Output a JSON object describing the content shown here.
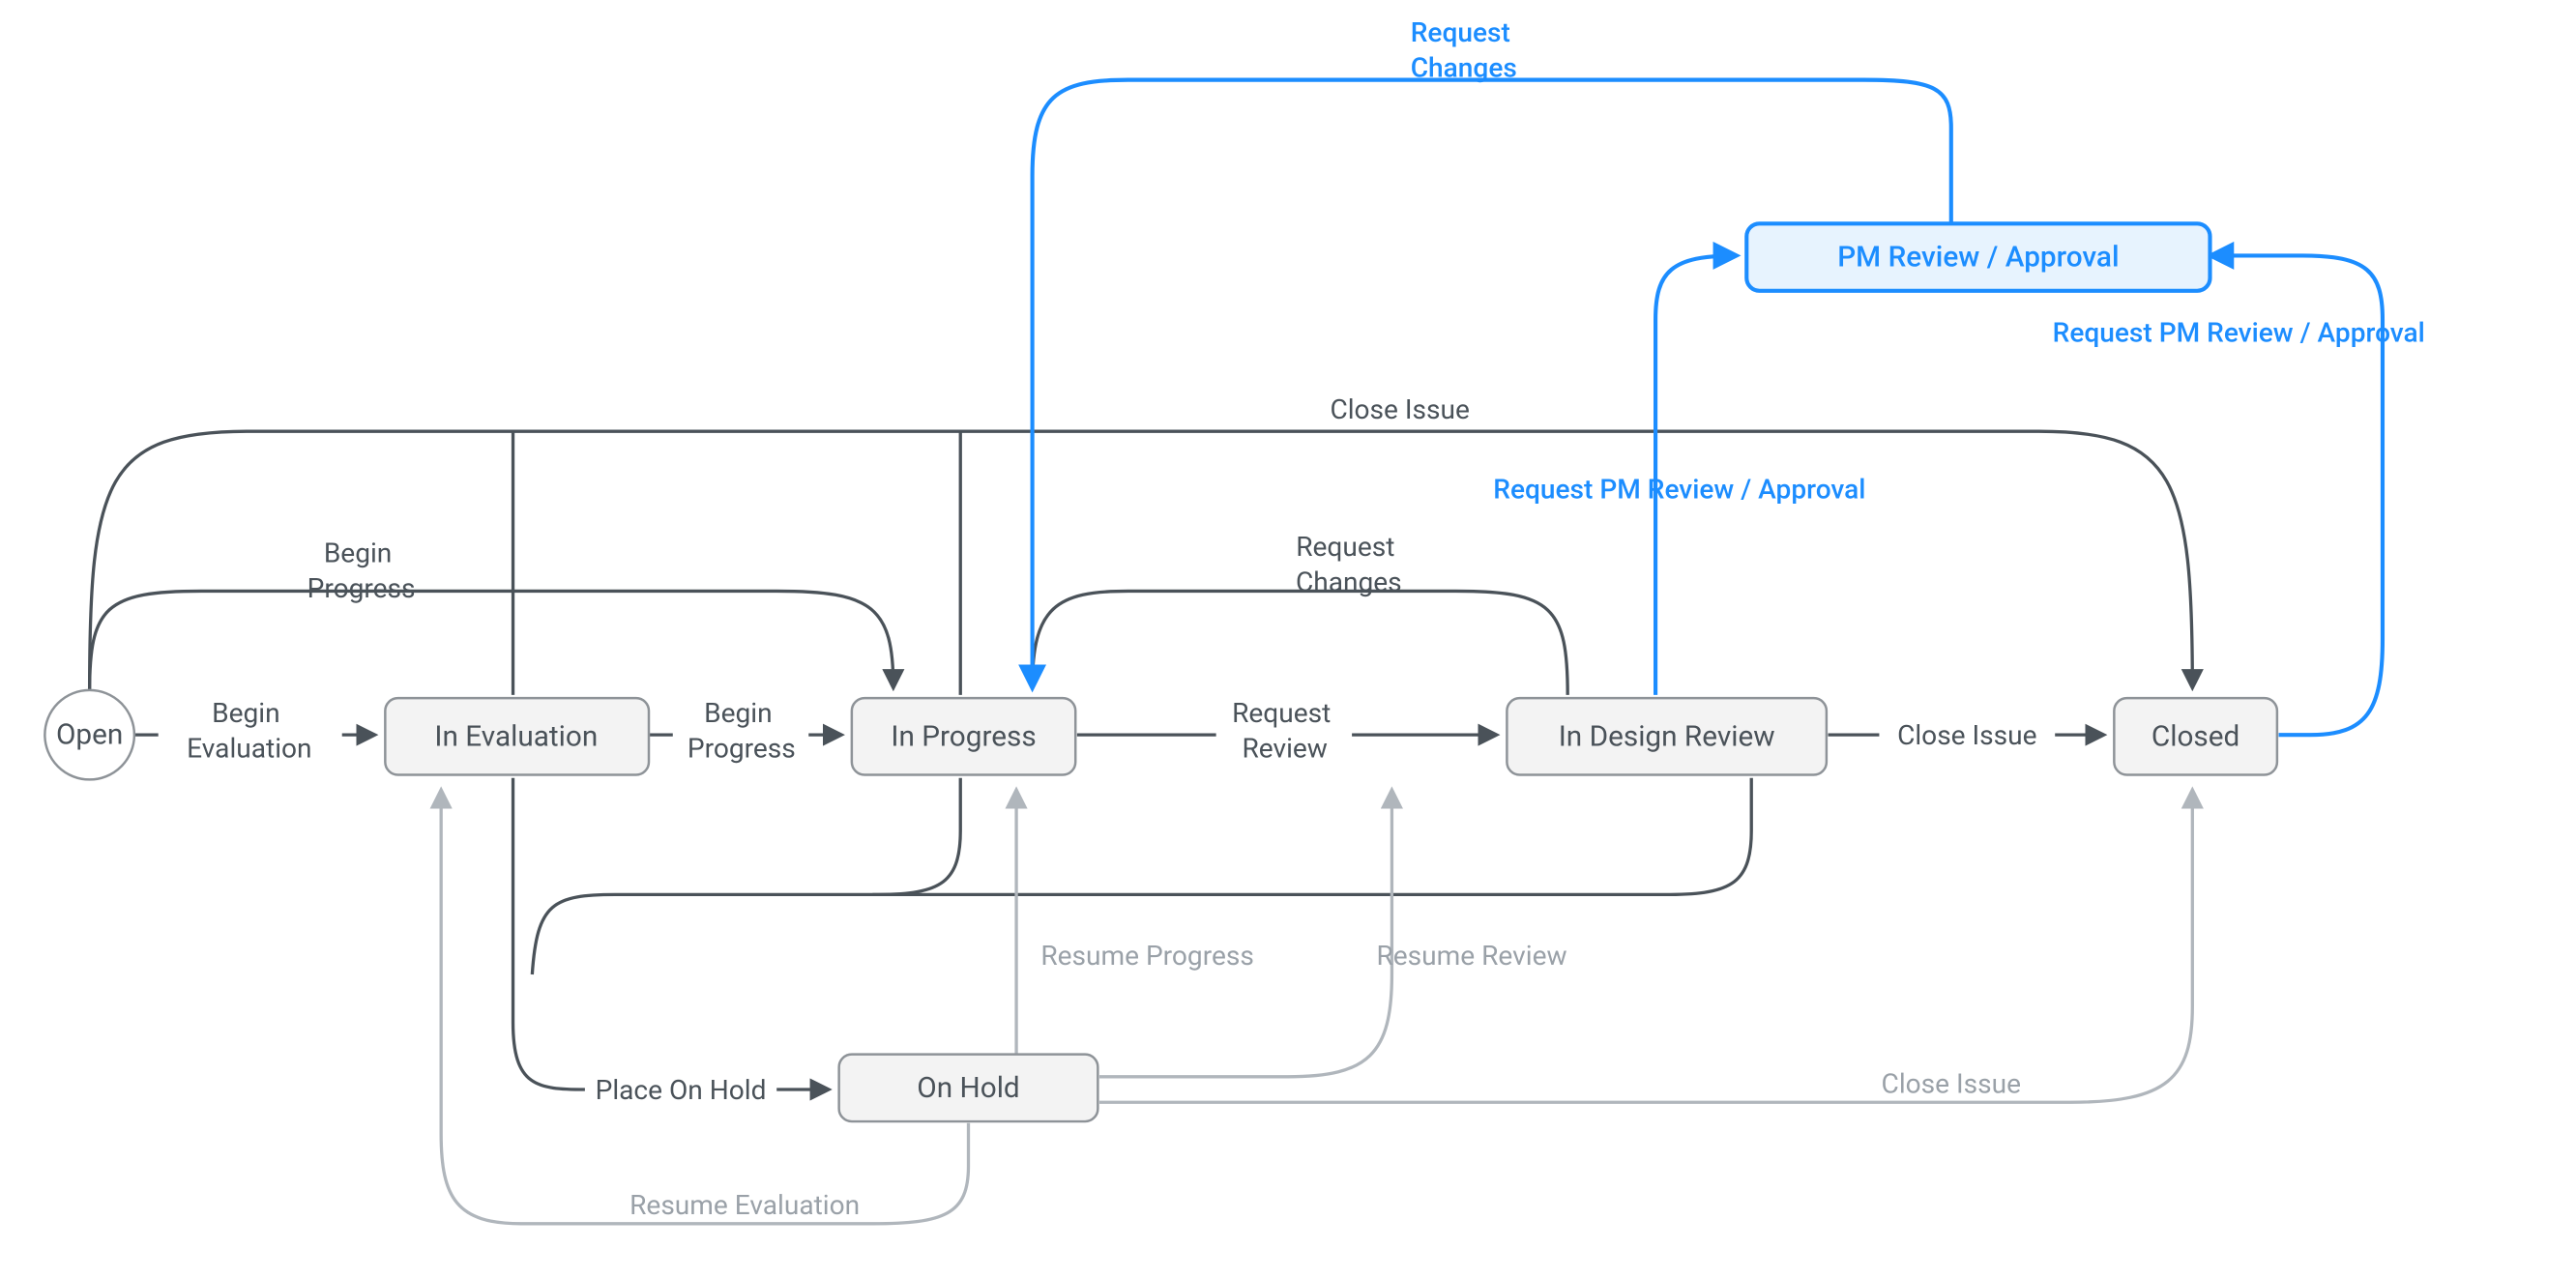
{
  "colors": {
    "dark": "#4a5259",
    "light": "#b0b6bc",
    "blue": "#1c8dff",
    "node_fill": "#f3f3f3",
    "node_highlight_fill": "#e7f3fe"
  },
  "nodes": {
    "open": {
      "label": "Open",
      "shape": "circle",
      "highlight": false
    },
    "in_evaluation": {
      "label": "In Evaluation",
      "shape": "rounded",
      "highlight": false
    },
    "in_progress": {
      "label": "In Progress",
      "shape": "rounded",
      "highlight": false
    },
    "in_design_review": {
      "label": "In Design Review",
      "shape": "rounded",
      "highlight": false
    },
    "closed": {
      "label": "Closed",
      "shape": "rounded",
      "highlight": false
    },
    "on_hold": {
      "label": "On Hold",
      "shape": "rounded",
      "highlight": false
    },
    "pm_review": {
      "label": "PM Review / Approval",
      "shape": "rounded",
      "highlight": true
    }
  },
  "edges": {
    "begin_evaluation": {
      "from": "open",
      "to": "in_evaluation",
      "label_lines": [
        "Begin",
        "Evaluation"
      ],
      "style": "dark"
    },
    "begin_progress": {
      "from": "in_evaluation",
      "to": "in_progress",
      "label_lines": [
        "Begin",
        "Progress"
      ],
      "style": "dark"
    },
    "request_review": {
      "from": "in_progress",
      "to": "in_design_review",
      "label_lines": [
        "Request",
        "Review"
      ],
      "style": "dark"
    },
    "close_issue_main": {
      "from": "in_design_review",
      "to": "closed",
      "label_lines": [
        "Close Issue"
      ],
      "style": "dark"
    },
    "place_on_hold": {
      "from": "in_evaluation",
      "to": "on_hold",
      "label_lines": [
        "Place On Hold"
      ],
      "style": "dark"
    },
    "begin_progress_top": {
      "from": "open",
      "to": "in_progress",
      "label_lines": [
        "Begin",
        "Progress"
      ],
      "style": "dark"
    },
    "request_changes": {
      "from": "in_design_review",
      "to": "in_progress",
      "label_lines": [
        "Request",
        "Changes"
      ],
      "style": "dark"
    },
    "close_issue_top": {
      "from": "open",
      "to": "closed",
      "label_lines": [
        "Close Issue"
      ],
      "style": "dark",
      "also_from": [
        "in_evaluation",
        "in_progress"
      ]
    },
    "resume_progress": {
      "from": "on_hold",
      "to": "in_progress",
      "label_lines": [
        "Resume Progress"
      ],
      "style": "light"
    },
    "resume_review": {
      "from": "on_hold",
      "to": "in_design_review",
      "label_lines": [
        "Resume Review"
      ],
      "style": "light"
    },
    "resume_evaluation": {
      "from": "on_hold",
      "to": "in_evaluation",
      "label_lines": [
        "Resume Evaluation"
      ],
      "style": "light"
    },
    "close_issue_hold": {
      "from": "on_hold",
      "to": "closed",
      "label_lines": [
        "Close Issue"
      ],
      "style": "light"
    },
    "request_pm_review": {
      "from": "in_design_review",
      "to": "pm_review",
      "label_lines": [
        "Request PM Review / Approval"
      ],
      "style": "blue"
    },
    "request_pm_review_closed": {
      "from": "closed",
      "to": "pm_review",
      "label_lines": [
        "Request PM Review / Approval"
      ],
      "style": "blue"
    },
    "pm_request_changes": {
      "from": "pm_review",
      "to": "in_progress",
      "label_lines": [
        "Request",
        "Changes"
      ],
      "style": "blue"
    }
  }
}
